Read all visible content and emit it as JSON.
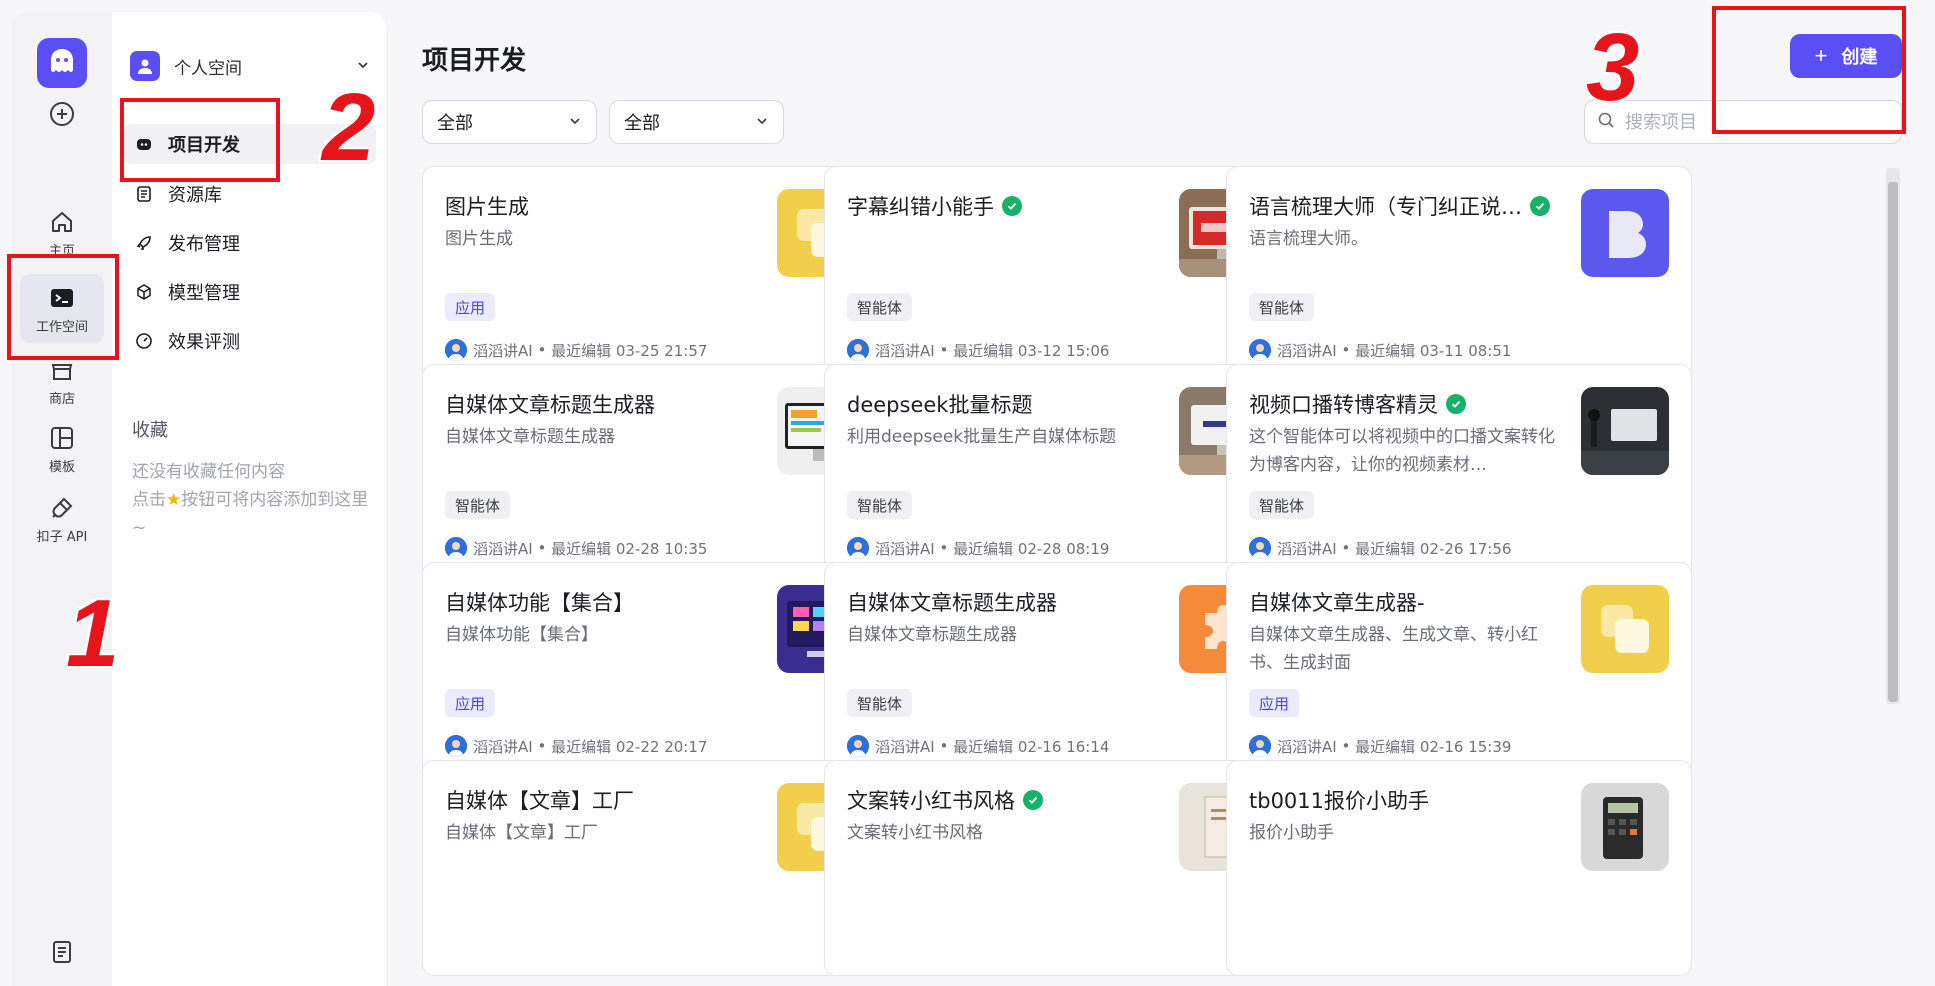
{
  "rail": {
    "items": [
      {
        "label": ""
      },
      {
        "label": "主页"
      },
      {
        "label": "工作空间"
      },
      {
        "label": "商店"
      },
      {
        "label": "模板"
      },
      {
        "label": "扣子 API"
      }
    ]
  },
  "sidebar": {
    "space_name": "个人空间",
    "nav": [
      {
        "label": "项目开发"
      },
      {
        "label": "资源库"
      },
      {
        "label": "发布管理"
      },
      {
        "label": "模型管理"
      },
      {
        "label": "效果评测"
      }
    ],
    "favorites_title": "收藏",
    "favorites_empty_1": "还没有收藏任何内容",
    "favorites_empty_2": "点击",
    "favorites_empty_3": "按钮可将内容添加到这里~"
  },
  "main": {
    "title": "项目开发",
    "create_label": "创建",
    "filter_type": "全部",
    "filter_status": "全部",
    "search_placeholder": "搜索项目"
  },
  "cards": [
    {
      "title": "图片生成",
      "verified": false,
      "desc": "图片生成",
      "tag": "应用",
      "tag_type": "app",
      "author": "滔滔讲AI",
      "edited": "最近编辑 03-25 21:57",
      "thumb": "tiles-yellow"
    },
    {
      "title": "字幕纠错小能手",
      "verified": true,
      "desc": "",
      "tag": "智能体",
      "tag_type": "agent",
      "author": "滔滔讲AI",
      "edited": "最近编辑 03-12 15:06",
      "thumb": "error-monitor"
    },
    {
      "title": "语言梳理大师（专门纠正说…",
      "verified": true,
      "desc": "语言梳理大师。",
      "tag": "智能体",
      "tag_type": "agent",
      "author": "滔滔讲AI",
      "edited": "最近编辑 03-11 08:51",
      "thumb": "purple-b"
    },
    {
      "title": "自媒体文章标题生成器",
      "verified": false,
      "desc": "自媒体文章标题生成器",
      "tag": "智能体",
      "tag_type": "agent",
      "author": "滔滔讲AI",
      "edited": "最近编辑 02-28 10:35",
      "thumb": "imac"
    },
    {
      "title": "deepseek批量标题",
      "verified": false,
      "desc": "利用deepseek批量生产自媒体标题",
      "tag": "智能体",
      "tag_type": "agent",
      "author": "滔滔讲AI",
      "edited": "最近编辑 02-28 08:19",
      "thumb": "deepseek-monitor"
    },
    {
      "title": "视频口播转博客精灵",
      "verified": true,
      "desc": "这个智能体可以将视频中的口播文案转化为博客内容，让你的视频素材…",
      "tag": "智能体",
      "tag_type": "agent",
      "author": "滔滔讲AI",
      "edited": "最近编辑 02-26 17:56",
      "thumb": "dark-studio"
    },
    {
      "title": "自媒体功能【集合】",
      "verified": false,
      "desc": "自媒体功能【集合】",
      "tag": "应用",
      "tag_type": "app",
      "author": "滔滔讲AI",
      "edited": "最近编辑 02-22 20:17",
      "thumb": "neon-screen"
    },
    {
      "title": "自媒体文章标题生成器",
      "verified": false,
      "desc": "自媒体文章标题生成器",
      "tag": "智能体",
      "tag_type": "agent",
      "author": "滔滔讲AI",
      "edited": "最近编辑 02-16 16:14",
      "thumb": "puzzle-orange"
    },
    {
      "title": "自媒体文章生成器-",
      "verified": false,
      "desc": "自媒体文章生成器、生成文章、转小红书、生成封面",
      "tag": "应用",
      "tag_type": "app",
      "author": "滔滔讲AI",
      "edited": "最近编辑 02-16 15:39",
      "thumb": "tiles-yellow"
    },
    {
      "title": "自媒体【文章】工厂",
      "verified": false,
      "desc": "自媒体【文章】工厂",
      "tag": "",
      "tag_type": "app",
      "author": "",
      "edited": "",
      "thumb": "tiles-yellow"
    },
    {
      "title": "文案转小红书风格",
      "verified": true,
      "desc": "文案转小红书风格",
      "tag": "",
      "tag_type": "agent",
      "author": "",
      "edited": "",
      "thumb": "book"
    },
    {
      "title": "tb0011报价小助手",
      "verified": false,
      "desc": "报价小助手",
      "tag": "",
      "tag_type": "agent",
      "author": "",
      "edited": "",
      "thumb": "calculator"
    }
  ],
  "annotations": [
    "1",
    "2",
    "3"
  ],
  "colors": {
    "accent": "#5a4ff5",
    "annotation": "#e8141c",
    "verified": "#17b26a"
  }
}
